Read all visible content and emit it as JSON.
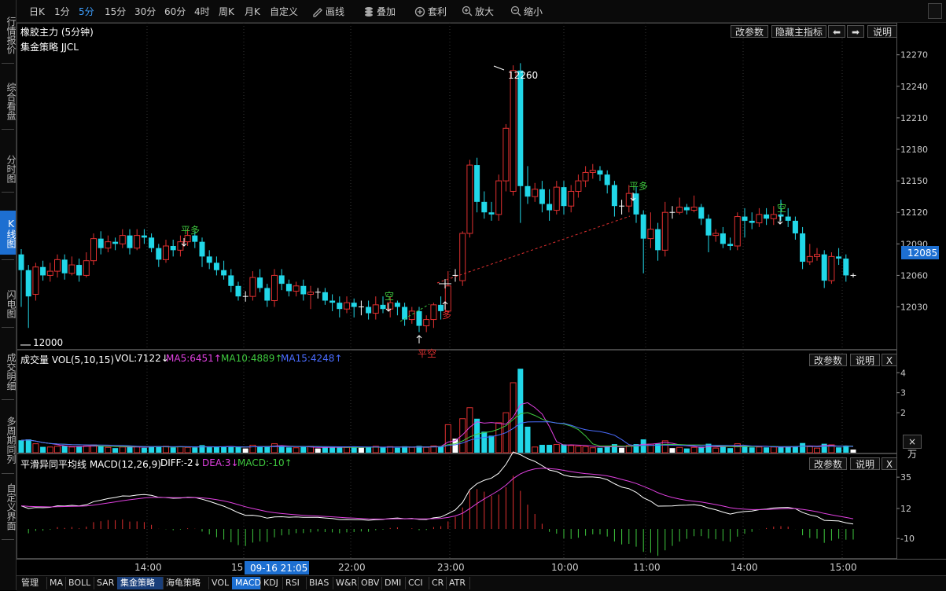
{
  "sidebar": {
    "tabs": [
      {
        "label": "行情报价",
        "active": false
      },
      {
        "label": "综合看盘",
        "active": false
      },
      {
        "label": "分时图",
        "active": false
      },
      {
        "label": "K线图",
        "active": true
      },
      {
        "label": "闪电图",
        "active": false
      },
      {
        "label": "成交明细",
        "active": false
      },
      {
        "label": "多周期同列",
        "active": false
      },
      {
        "label": "自定义界面",
        "active": false
      }
    ]
  },
  "toolbar": {
    "periods": [
      "日K",
      "1分",
      "5分",
      "15分",
      "30分",
      "60分",
      "4时",
      "周K",
      "月K",
      "自定义"
    ],
    "active_period": "5分",
    "tools": [
      {
        "label": "画线",
        "icon": "pencil-icon"
      },
      {
        "label": "叠加",
        "icon": "stack-icon"
      },
      {
        "label": "套利",
        "icon": "arbitrage-icon"
      },
      {
        "label": "放大",
        "icon": "zoom-in-icon"
      },
      {
        "label": "缩小",
        "icon": "zoom-out-icon"
      }
    ]
  },
  "main_panel": {
    "title": "橡胶主力 (5分钟)",
    "strategy": "集金策略 JJCL",
    "buttons": [
      "改参数",
      "隐藏主指标",
      "说明"
    ],
    "high_label": "12260",
    "low_label": "12000",
    "current_price": "12085",
    "signals": [
      {
        "text": "平多",
        "color": "#3ec83e"
      },
      {
        "text": "空",
        "color": "#3ec83e"
      },
      {
        "text": "平空",
        "color": "#e03030"
      },
      {
        "text": "多",
        "color": "#e03030"
      },
      {
        "text": "平多",
        "color": "#3ec83e"
      },
      {
        "text": "空",
        "color": "#3ec83e"
      }
    ]
  },
  "volume_panel": {
    "name": "成交量 VOL(5,10,15)",
    "vol": "VOL:7122↓",
    "ma5": "MA5:6451↑",
    "ma10": "MA10:4889↑",
    "ma15": "MA15:4248↑",
    "buttons": [
      "改参数",
      "说明",
      "X"
    ],
    "unit_button": "×万"
  },
  "macd_panel": {
    "name": "平滑异同平均线 MACD(12,26,9)",
    "diff": "DIFF:-2↓",
    "dea": "DEA:3↓",
    "macd": "MACD:-10↑",
    "buttons": [
      "改参数",
      "说明",
      "X"
    ]
  },
  "cursor_time": "09-16 21:05",
  "bottom_tabs": [
    {
      "label": "管理",
      "active": false
    },
    {
      "label": "MA",
      "active": false
    },
    {
      "label": "BOLL",
      "active": false
    },
    {
      "label": "SAR",
      "active": false
    },
    {
      "label": "集金策略",
      "active": true
    },
    {
      "label": "海龟策略",
      "active": false
    },
    {
      "label": "VOL",
      "active": false
    },
    {
      "label": "MACD",
      "active": true
    },
    {
      "label": "KDJ",
      "active": false
    },
    {
      "label": "RSI",
      "active": false
    },
    {
      "label": "BIAS",
      "active": false
    },
    {
      "label": "W&R",
      "active": false
    },
    {
      "label": "OBV",
      "active": false
    },
    {
      "label": "DMI",
      "active": false
    },
    {
      "label": "CCI",
      "active": false
    },
    {
      "label": "CR",
      "active": false
    },
    {
      "label": "ATR",
      "active": false
    }
  ],
  "colors": {
    "up": "#e03030",
    "down": "#21d7e8",
    "ma5": "#ffffff",
    "ma10": "#e8e840",
    "ma15": "#e040e0",
    "macd_pos": "#e03030",
    "macd_neg": "#3ec83e",
    "dea": "#e040e0",
    "diff": "#ffffff"
  },
  "chart_data": {
    "type": "candlestick",
    "price_axis": [
      12270,
      12240,
      12210,
      12180,
      12150,
      12120,
      12090,
      12060,
      12030
    ],
    "volume_axis": [
      4,
      3,
      2
    ],
    "macd_axis": [
      35,
      12,
      -10
    ],
    "time_labels": [
      "14:00",
      "15",
      "22:00",
      "23:00",
      "10:00",
      "11:00",
      "14:00",
      "15:00"
    ],
    "candles": [
      [
        12080,
        12065,
        12085,
        12030
      ],
      [
        12065,
        12040,
        12070,
        12010
      ],
      [
        12042,
        12068,
        12072,
        12036
      ],
      [
        12068,
        12060,
        12074,
        12055
      ],
      [
        12060,
        12064,
        12072,
        12054
      ],
      [
        12064,
        12075,
        12080,
        12058
      ],
      [
        12075,
        12062,
        12080,
        12056
      ],
      [
        12062,
        12070,
        12078,
        12060
      ],
      [
        12070,
        12060,
        12076,
        12054
      ],
      [
        12060,
        12074,
        12082,
        12058
      ],
      [
        12074,
        12095,
        12100,
        12070
      ],
      [
        12095,
        12086,
        12102,
        12080
      ],
      [
        12086,
        12092,
        12098,
        12082
      ],
      [
        12092,
        12090,
        12096,
        12084
      ],
      [
        12090,
        12098,
        12104,
        12086
      ],
      [
        12098,
        12086,
        12104,
        12080
      ],
      [
        12086,
        12098,
        12104,
        12084
      ],
      [
        12098,
        12096,
        12104,
        12090
      ],
      [
        12096,
        12086,
        12100,
        12082
      ],
      [
        12086,
        12075,
        12090,
        12068
      ],
      [
        12075,
        12088,
        12094,
        12072
      ],
      [
        12088,
        12084,
        12094,
        12078
      ],
      [
        12084,
        12092,
        12098,
        12078
      ],
      [
        12092,
        12098,
        12104,
        12088
      ],
      [
        12098,
        12092,
        12102,
        12086
      ],
      [
        12092,
        12078,
        12096,
        12068
      ],
      [
        12078,
        12072,
        12084,
        12066
      ],
      [
        12072,
        12065,
        12078,
        12060
      ],
      [
        12065,
        12060,
        12074,
        12056
      ],
      [
        12060,
        12050,
        12066,
        12044
      ],
      [
        12050,
        12040,
        12054,
        12036
      ],
      [
        12040,
        12040,
        12045,
        12035
      ],
      [
        12040,
        12058,
        12064,
        12036
      ],
      [
        12058,
        12048,
        12066,
        12044
      ],
      [
        12048,
        12036,
        12052,
        12030
      ],
      [
        12036,
        12060,
        12066,
        12030
      ],
      [
        12060,
        12052,
        12066,
        12046
      ],
      [
        12052,
        12045,
        12056,
        12040
      ],
      [
        12045,
        12050,
        12054,
        12040
      ],
      [
        12050,
        12042,
        12056,
        12036
      ],
      [
        12042,
        12044,
        12050,
        12028
      ],
      [
        12044,
        12044,
        12048,
        12038
      ],
      [
        12044,
        12036,
        12048,
        12032
      ],
      [
        12036,
        12034,
        12042,
        12026
      ],
      [
        12034,
        12028,
        12040,
        12020
      ],
      [
        12028,
        12034,
        12040,
        12024
      ],
      [
        12034,
        12030,
        12038,
        12020
      ],
      [
        12030,
        12030,
        12036,
        12022
      ],
      [
        12030,
        12024,
        12036,
        12018
      ],
      [
        12024,
        12032,
        12040,
        12018
      ],
      [
        12032,
        12028,
        12040,
        12024
      ],
      [
        12028,
        12034,
        12040,
        12020
      ],
      [
        12034,
        12030,
        12036,
        12022
      ],
      [
        12030,
        12018,
        12034,
        12012
      ],
      [
        12018,
        12026,
        12030,
        12014
      ],
      [
        12026,
        12012,
        12030,
        12006
      ],
      [
        12012,
        12018,
        12022,
        12006
      ],
      [
        12018,
        12032,
        12034,
        12010
      ],
      [
        12032,
        12026,
        12040,
        12018
      ],
      [
        12026,
        12050,
        12064,
        12024
      ],
      [
        12060,
        12060,
        12066,
        12054
      ],
      [
        12055,
        12100,
        12102,
        12050
      ],
      [
        12100,
        12165,
        12170,
        12096
      ],
      [
        12165,
        12130,
        12172,
        12120
      ],
      [
        12130,
        12120,
        12140,
        12114
      ],
      [
        12120,
        12118,
        12130,
        12112
      ],
      [
        12118,
        12150,
        12156,
        12112
      ],
      [
        12150,
        12200,
        12204,
        12140
      ],
      [
        12140,
        12255,
        12260,
        12136
      ],
      [
        12255,
        12145,
        12262,
        12110
      ],
      [
        12145,
        12135,
        12164,
        12128
      ],
      [
        12135,
        12142,
        12148,
        12130
      ],
      [
        12142,
        12128,
        12150,
        12120
      ],
      [
        12128,
        12122,
        12142,
        12112
      ],
      [
        12122,
        12144,
        12150,
        12118
      ],
      [
        12144,
        12126,
        12150,
        12118
      ],
      [
        12126,
        12140,
        12146,
        12120
      ],
      [
        12140,
        12150,
        12156,
        12134
      ],
      [
        12150,
        12158,
        12164,
        12144
      ],
      [
        12158,
        12160,
        12166,
        12152
      ],
      [
        12160,
        12156,
        12164,
        12150
      ],
      [
        12156,
        12146,
        12160,
        12138
      ],
      [
        12146,
        12126,
        12150,
        12116
      ],
      [
        12126,
        12126,
        12132,
        12118
      ],
      [
        12126,
        12138,
        12146,
        12120
      ],
      [
        12138,
        12118,
        12144,
        12110
      ],
      [
        12118,
        12095,
        12122,
        12062
      ],
      [
        12095,
        12104,
        12120,
        12086
      ],
      [
        12104,
        12084,
        12110,
        12074
      ],
      [
        12084,
        12120,
        12130,
        12078
      ],
      [
        12120,
        12120,
        12126,
        12114
      ],
      [
        12120,
        12125,
        12134,
        12118
      ],
      [
        12125,
        12122,
        12128,
        12118
      ],
      [
        12122,
        12125,
        12136,
        12120
      ],
      [
        12125,
        12114,
        12128,
        12108
      ],
      [
        12114,
        12098,
        12118,
        12082
      ],
      [
        12098,
        12100,
        12104,
        12092
      ],
      [
        12100,
        12090,
        12106,
        12086
      ],
      [
        12090,
        12088,
        12096,
        12084
      ],
      [
        12088,
        12116,
        12120,
        12084
      ],
      [
        12116,
        12112,
        12124,
        12096
      ],
      [
        12112,
        12110,
        12120,
        12104
      ],
      [
        12110,
        12118,
        12124,
        12106
      ],
      [
        12118,
        12114,
        12124,
        12108
      ],
      [
        12114,
        12118,
        12126,
        12108
      ],
      [
        12118,
        12116,
        12132,
        12112
      ],
      [
        12116,
        12112,
        12124,
        12106
      ],
      [
        12112,
        12100,
        12116,
        12094
      ],
      [
        12100,
        12073,
        12106,
        12066
      ],
      [
        12073,
        12078,
        12090,
        12070
      ],
      [
        12078,
        12080,
        12086,
        12074
      ],
      [
        12080,
        12055,
        12084,
        12048
      ],
      [
        12055,
        12078,
        12082,
        12052
      ],
      [
        12078,
        12076,
        12086,
        12070
      ],
      [
        12076,
        12060,
        12080,
        12054
      ],
      [
        12060,
        12060,
        12062,
        12058
      ]
    ]
  }
}
